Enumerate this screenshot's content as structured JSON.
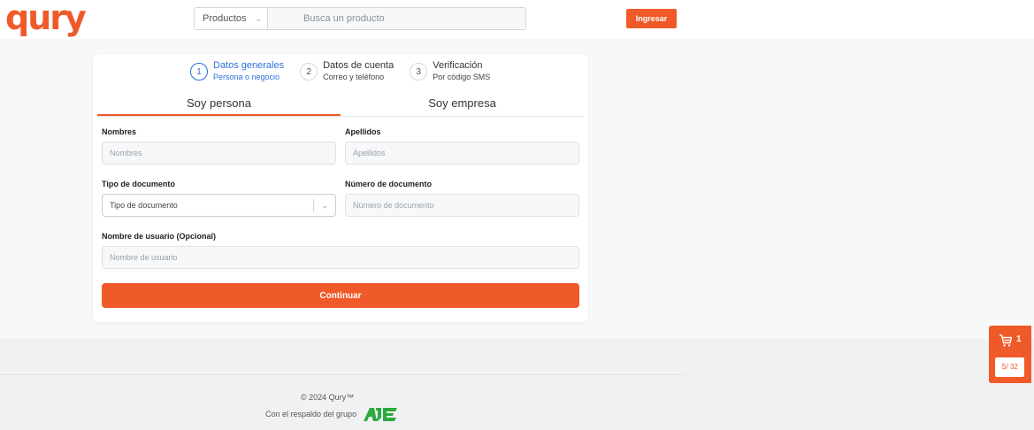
{
  "header": {
    "logo_text": "qury",
    "category_select": {
      "value": "Productos",
      "icon": "chevron-down-icon"
    },
    "search": {
      "placeholder": "Busca un producto"
    },
    "login_label": "Ingresar"
  },
  "colors": {
    "brand": "#ef5a28",
    "step_active": "#2c6fdc",
    "aje_green": "#2bab3f"
  },
  "steps": [
    {
      "number": "1",
      "title": "Datos generales",
      "subtitle": "Persona o negocio",
      "active": true
    },
    {
      "number": "2",
      "title": "Datos de cuenta",
      "subtitle": "Correo y teléfono",
      "active": false
    },
    {
      "number": "3",
      "title": "Verificación",
      "subtitle": "Por código SMS",
      "active": false
    }
  ],
  "tabs": [
    {
      "label": "Soy persona",
      "active": true
    },
    {
      "label": "Soy empresa",
      "active": false
    }
  ],
  "form": {
    "nombres": {
      "label": "Nombres",
      "placeholder": "Nombres"
    },
    "apellidos": {
      "label": "Apellidos",
      "placeholder": "Apellidos"
    },
    "tipo_documento": {
      "label": "Tipo de documento",
      "value": "Tipo de documento"
    },
    "numero_documento": {
      "label": "Número de documento",
      "placeholder": "Número de documento"
    },
    "usuario": {
      "label": "Nombre de usuario (Opcional)",
      "placeholder": "Nombre de usuario"
    },
    "submit_label": "Continuar"
  },
  "footer": {
    "copyright": "© 2024 Qury™",
    "backing_text": "Con el respaldo del grupo",
    "group_logo_text": "AJE"
  },
  "cart": {
    "icon": "cart-icon",
    "count": "1",
    "total": "S/ 32"
  }
}
